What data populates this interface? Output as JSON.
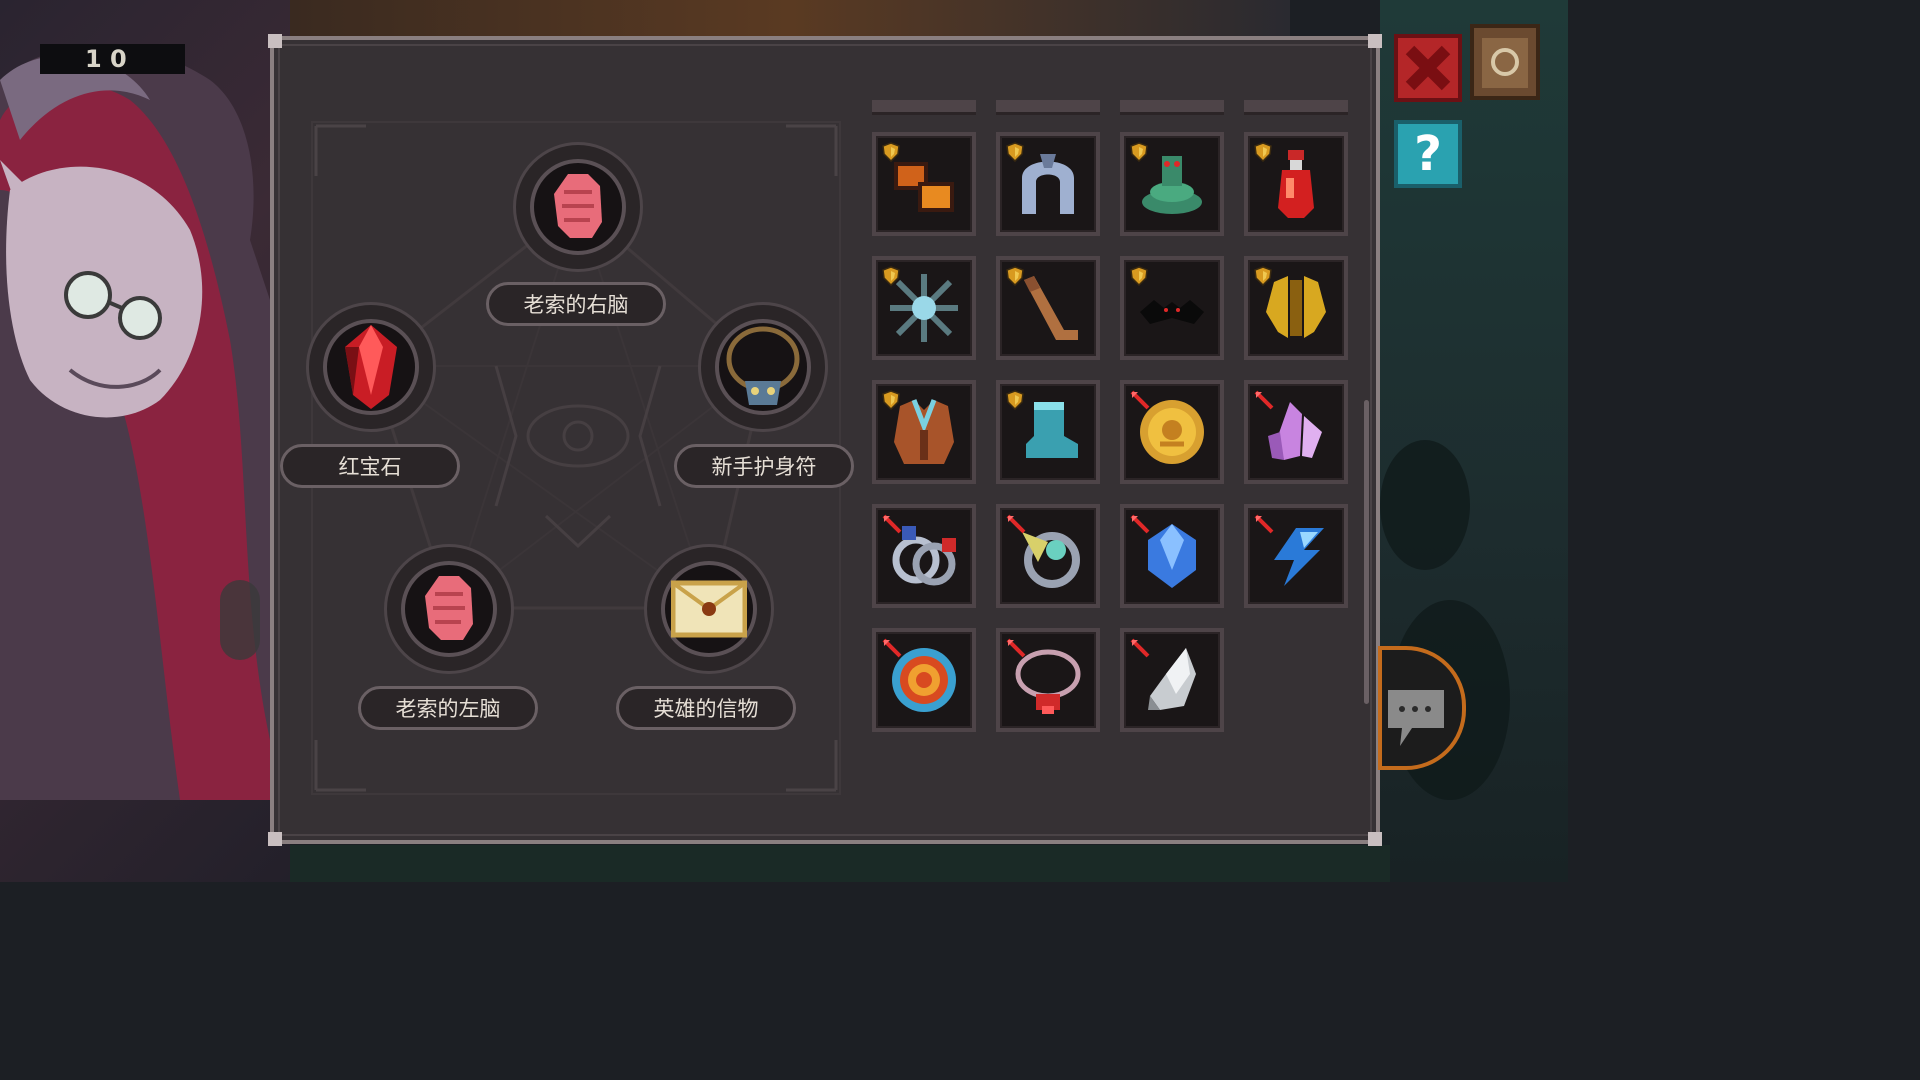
{
  "hud": {
    "counter_text": "1 0"
  },
  "ritual": {
    "slots": [
      {
        "label": "老索的右脑",
        "icon": "brain-icon"
      },
      {
        "label": "红宝石",
        "icon": "ruby-icon"
      },
      {
        "label": "新手护身符",
        "icon": "amulet-icon"
      },
      {
        "label": "老索的左脑",
        "icon": "brain-icon"
      },
      {
        "label": "英雄的信物",
        "icon": "letter-icon"
      }
    ]
  },
  "inventory": {
    "items": [
      {
        "icon": "lava-boots-icon",
        "badge": "shield"
      },
      {
        "icon": "steel-arch-icon",
        "badge": "shield"
      },
      {
        "icon": "snake-icon",
        "badge": "shield"
      },
      {
        "icon": "red-potion-icon",
        "badge": "shield"
      },
      {
        "icon": "ice-cross-icon",
        "badge": "shield"
      },
      {
        "icon": "hockey-stick-icon",
        "badge": "shield"
      },
      {
        "icon": "black-bat-icon",
        "badge": "shield"
      },
      {
        "icon": "gold-armor-icon",
        "badge": "shield"
      },
      {
        "icon": "leather-vest-icon",
        "badge": "shield"
      },
      {
        "icon": "teal-boot-icon",
        "badge": "shield"
      },
      {
        "icon": "gold-coin-icon",
        "badge": "red-sword"
      },
      {
        "icon": "purple-crystal-icon",
        "badge": "red-sword"
      },
      {
        "icon": "silver-rings-icon",
        "badge": "red-sword"
      },
      {
        "icon": "magnifier-ring-icon",
        "badge": "red-sword"
      },
      {
        "icon": "blue-gem-icon",
        "badge": "red-sword"
      },
      {
        "icon": "lightning-icon",
        "badge": "red-sword"
      },
      {
        "icon": "target-icon",
        "badge": "red-sword"
      },
      {
        "icon": "necklace-icon",
        "badge": "red-sword"
      },
      {
        "icon": "silver-claw-icon",
        "badge": "red-sword"
      }
    ]
  },
  "buttons": {
    "help_label": "?"
  },
  "colors": {
    "panel": "#363134",
    "panel_border": "#8a7f80",
    "close": "#b42628",
    "help": "#2aa2b0",
    "chat_ring": "#c46b1c"
  }
}
